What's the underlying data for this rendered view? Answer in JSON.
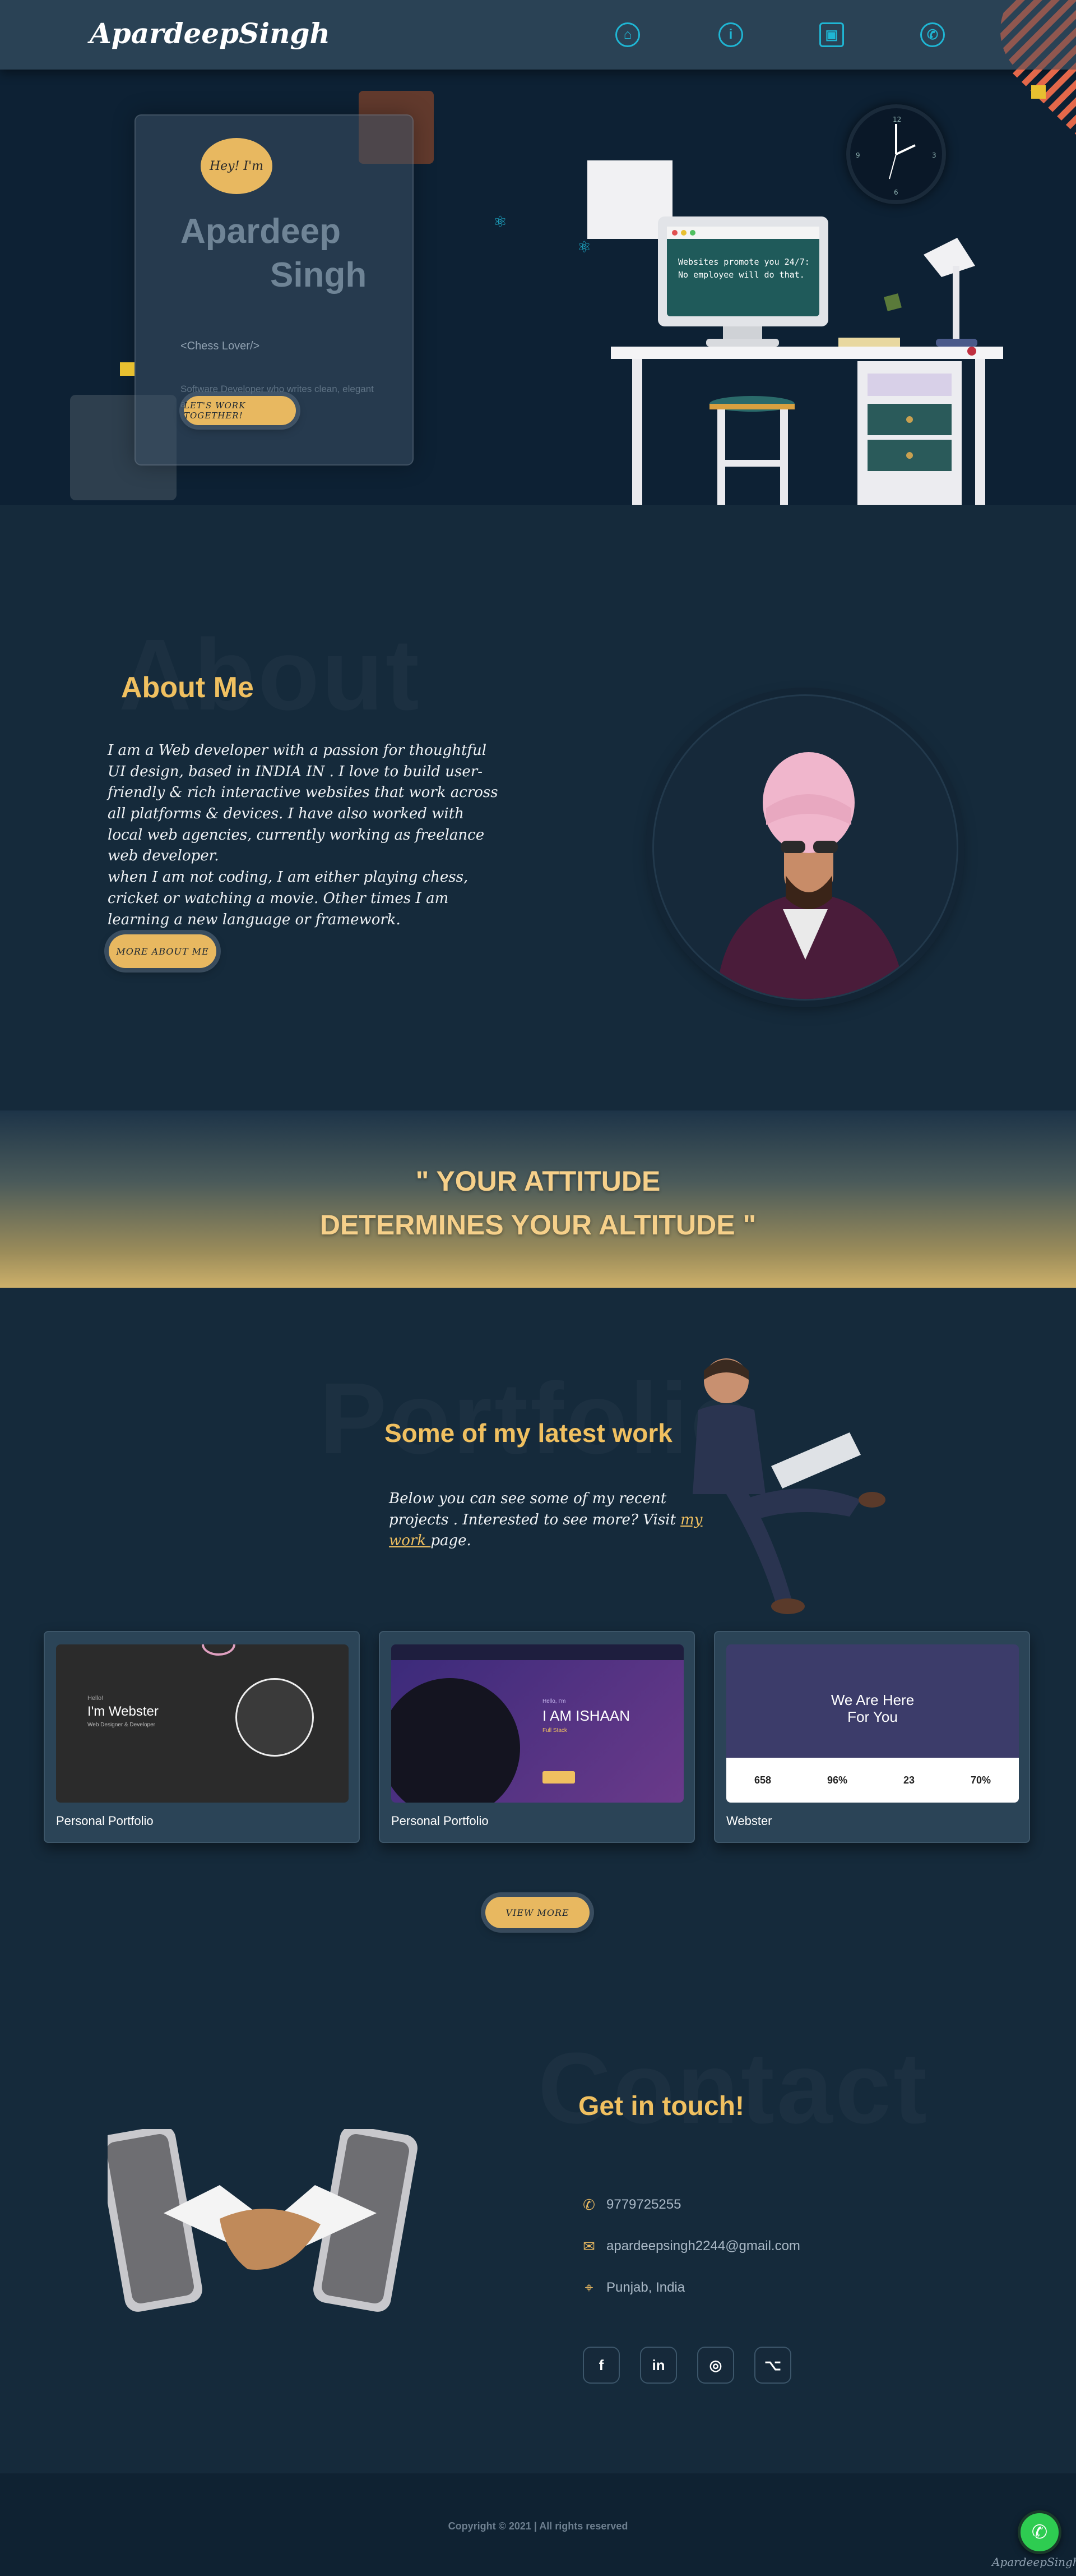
{
  "nav": {
    "logo": "ApardeepSingh",
    "items": [
      {
        "icon": "home-icon",
        "glyph": "⌂"
      },
      {
        "icon": "info-icon",
        "glyph": "i"
      },
      {
        "icon": "portfolio-icon",
        "glyph": "▣"
      },
      {
        "icon": "phone-icon",
        "glyph": "✆"
      }
    ]
  },
  "hero": {
    "greeting": "Hey! I'm",
    "name_first": "Apardeep",
    "name_last": "Singh",
    "tagline": "<Chess Lover/>",
    "description": "Software Developer who writes clean, elegant and efficient code.",
    "cta": "LET'S WORK TOGETHER!",
    "monitor_line1": "Websites promote you 24/7:",
    "monitor_line2": "No employee will do that."
  },
  "about": {
    "ghost": "About",
    "title": "About Me",
    "text": "I am a Web developer with a passion for thoughtful UI design, based in INDIA IN . I love to build user-friendly & rich interactive websites that work across all platforms & devices. I have also worked with local web agencies, currently working as freelance web developer.",
    "text2": "when I am not coding, I am either playing chess, cricket or watching a movie. Other times I am learning a new language or framework.",
    "button": "MORE ABOUT ME"
  },
  "quote": {
    "line1": "\" YOUR ATTITUDE",
    "line2": "DETERMINES YOUR ALTITUDE \""
  },
  "portfolio": {
    "ghost": "Portfolio",
    "title": "Some of my latest work",
    "desc_part1": "Below you can see some of my recent projects . Interested to see more? Visit ",
    "desc_link": "my work ",
    "desc_part2": "page.",
    "cards": [
      {
        "label": "Personal Portfolio",
        "thumb_small": "Hello!",
        "thumb_title": "I'm Webster",
        "thumb_sub": "Web Designer & Developer"
      },
      {
        "label": "Personal Portfolio",
        "thumb_small": "Hello, I'm",
        "thumb_title": "I AM ISHAAN",
        "thumb_sub": "Full Stack"
      },
      {
        "label": "Webster",
        "thumb_title": "We Are Here",
        "thumb_title2": "For You",
        "stats": [
          "658",
          "96%",
          "23",
          "70%"
        ]
      }
    ],
    "view_more": "VIEW MORE"
  },
  "contact": {
    "ghost": "Contact",
    "title": "Get in touch!",
    "phone": "9779725255",
    "email": "apardeepsingh2244@gmail.com",
    "location": "Punjab, India",
    "socials": [
      {
        "icon": "facebook-icon",
        "glyph": "f"
      },
      {
        "icon": "linkedin-icon",
        "glyph": "in"
      },
      {
        "icon": "instagram-icon",
        "glyph": "◎"
      },
      {
        "icon": "github-icon",
        "glyph": "⌥"
      }
    ]
  },
  "footer": {
    "copyright": "Copyright © 2021 | All rights reserved",
    "signature": "ApardeepSingh"
  },
  "colors": {
    "accent": "#e8b860",
    "nav_icon": "#1fb6d4",
    "bg": "#152a3b"
  }
}
